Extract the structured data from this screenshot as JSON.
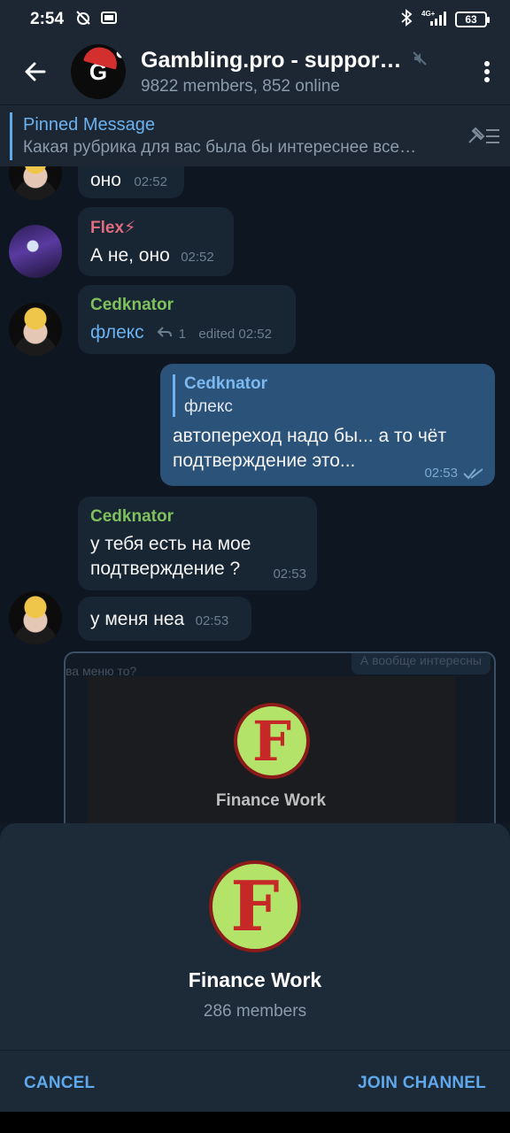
{
  "status_bar": {
    "time": "2:54",
    "battery": "63",
    "network": "4G+"
  },
  "header": {
    "title": "Gambling.pro - support…",
    "subtitle": "9822 members, 852 online",
    "avatar_letter": "G"
  },
  "pinned": {
    "title": "Pinned Message",
    "text": "Какая рубрика для вас была бы интереснее все…"
  },
  "messages": [
    {
      "text": "оно",
      "time": "02:52"
    },
    {
      "sender": "Flex⚡",
      "sender_color": "#e06c7f",
      "text": "А не, оно",
      "time": "02:52"
    },
    {
      "sender": "Cedknator",
      "sender_color": "#7fc15d",
      "text": "флекс",
      "replies": "1",
      "time": "edited 02:52"
    },
    {
      "reply_name": "Cedknator",
      "reply_text": "флекс",
      "text": "автопереход надо бы... а то чёт подтверждение это...",
      "time": "02:53"
    },
    {
      "sender": "Cedknator",
      "sender_color": "#7fc15d",
      "text": "у тебя есть на мое подтверждение ?",
      "time": "02:53"
    },
    {
      "text": "у меня неа",
      "time": "02:53"
    }
  ],
  "media_preview": {
    "ghost_left": "ва меню то?",
    "ghost_right": "А вообще интересны",
    "label": "Finance Work"
  },
  "sheet": {
    "logo_letter": "F",
    "title": "Finance Work",
    "subtitle": "286 members",
    "cancel_label": "CANCEL",
    "join_label": "JOIN CHANNEL"
  },
  "colors": {
    "accent": "#5fa8ec",
    "bubble_in": "#182533",
    "bubble_out": "#2b5278",
    "logo_green": "#b4e36a",
    "logo_red": "#c62828"
  }
}
